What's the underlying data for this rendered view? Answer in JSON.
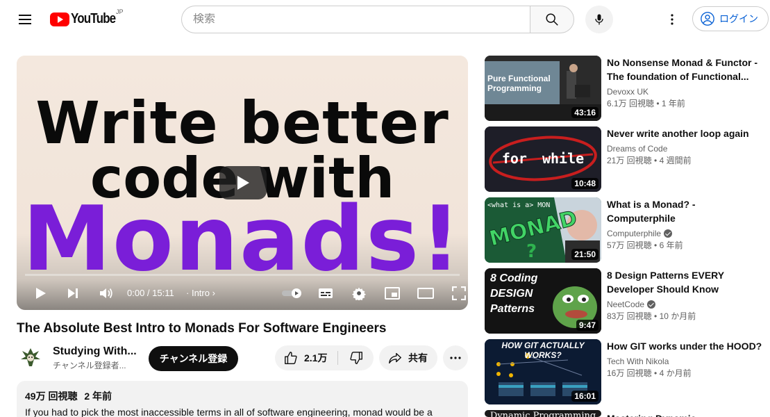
{
  "header": {
    "logo_text": "YouTube",
    "country": "JP",
    "search_placeholder": "検索",
    "login_label": "ログイン"
  },
  "player": {
    "line1": "Write better",
    "line2": "code with",
    "line3": "Monads!",
    "time": "0:00 / 15:11",
    "chapter": "Intro",
    "progress_fraction": 0.0
  },
  "video": {
    "title": "The Absolute Best Intro to Monads For Software Engineers",
    "channel_name": "Studying With...",
    "subscribers": "チャンネル登録者...",
    "subscribe_label": "チャンネル登録",
    "likes": "2.1万",
    "share_label": "共有",
    "views": "49万 回視聴",
    "age": "2 年前",
    "description": "If you had to pick the most inaccessible terms in all of software engineering, monad would be a"
  },
  "recommendations": [
    {
      "title": "No Nonsense Monad & Functor - The foundation of Functional...",
      "channel": "Devoxx UK",
      "verified": false,
      "views": "6.1万 回視聴",
      "age": "1 年前",
      "duration": "43:16",
      "thumb_text": "Pure Functional Programming"
    },
    {
      "title": "Never write another loop again",
      "channel": "Dreams of Code",
      "verified": false,
      "views": "21万 回視聴",
      "age": "4 週間前",
      "duration": "10:48",
      "thumb_text": "for while"
    },
    {
      "title": "What is a Monad? - Computerphile",
      "channel": "Computerphile",
      "verified": true,
      "views": "57万 回視聴",
      "age": "6 年前",
      "duration": "21:50",
      "thumb_text": "<what is a> MONAD ?"
    },
    {
      "title": "8 Design Patterns EVERY Developer Should Know",
      "channel": "NeetCode",
      "verified": true,
      "views": "83万 回視聴",
      "age": "10 か月前",
      "duration": "9:47",
      "thumb_text": "8 Coding DESIGN Patterns"
    },
    {
      "title": "How GIT works under the HOOD?",
      "channel": "Tech With Nikola",
      "verified": false,
      "views": "16万 回視聴",
      "age": "4 か月前",
      "duration": "16:01",
      "thumb_text": "HOW GIT ACTUALLY WORKS?"
    },
    {
      "title": "Mastering Dynamic",
      "channel": "",
      "verified": false,
      "views": "",
      "age": "",
      "duration": "",
      "thumb_text": "Dynamic Programming"
    }
  ]
}
